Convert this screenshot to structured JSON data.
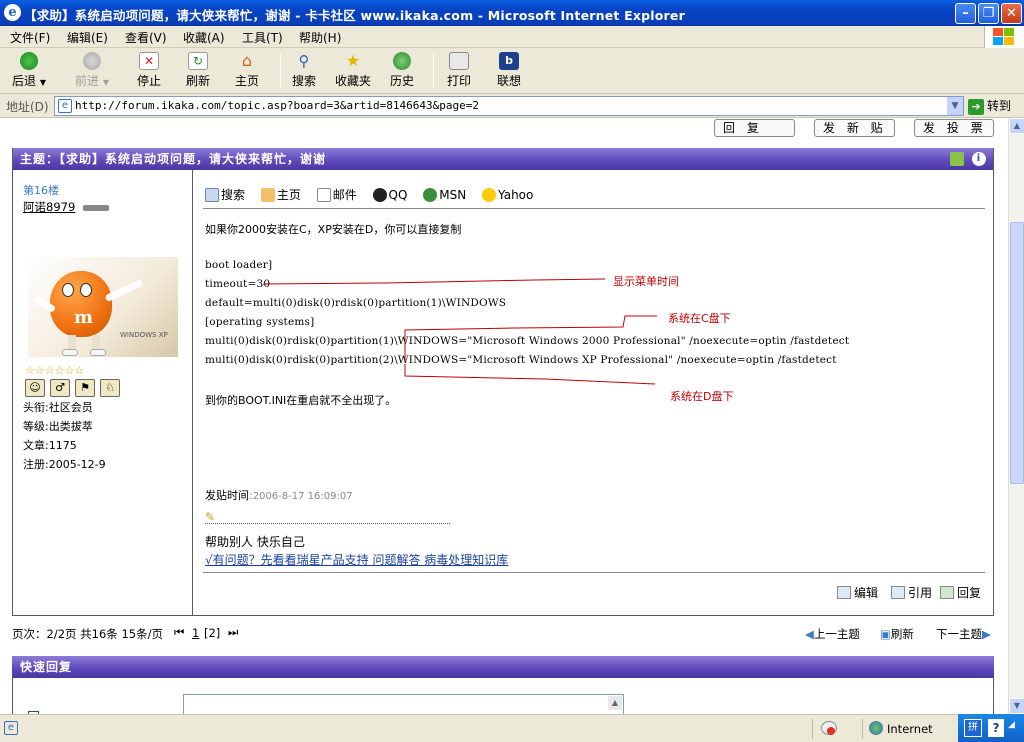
{
  "window": {
    "title": "【求助】系统启动项问题，请大侠来帮忙，谢谢 - 卡卡社区 www.ikaka.com - Microsoft Internet Explorer"
  },
  "menu": [
    "文件(F)",
    "编辑(E)",
    "查看(V)",
    "收藏(A)",
    "工具(T)",
    "帮助(H)"
  ],
  "toolbar": {
    "back": "后退",
    "forward": "前进",
    "stop": "停止",
    "refresh": "刷新",
    "home": "主页",
    "search": "搜索",
    "favorites": "收藏夹",
    "history": "历史",
    "print": "打印",
    "lenovo": "联想"
  },
  "address": {
    "label": "地址(D)",
    "url": "http://forum.ikaka.com/topic.asp?board=3&artid=8146643&page=2",
    "go": "转到"
  },
  "page": {
    "top_buttons": [
      "回 复",
      "发 新 贴",
      "发 投 票"
    ],
    "topic_header": "主题：【求助】系统启动项问题，请大侠来帮忙，谢谢",
    "post": {
      "floor": "第16楼",
      "username": "阿诺8979",
      "user_info": [
        "头衔:社区会员",
        "等级:出类拔萃",
        "文章:1175",
        "注册:2005-12-9"
      ],
      "links": [
        "搜索",
        "主页",
        "邮件",
        "QQ",
        "MSN",
        "Yahoo"
      ],
      "intro": "如果你2000安装在C，XP安装在D，你可以直接复制",
      "code": [
        "boot loader]",
        "timeout=30",
        "default=multi(0)disk(0)rdisk(0)partition(1)\\WINDOWS",
        "[operating systems]",
        "multi(0)disk(0)rdisk(0)partition(1)\\WINDOWS=\"Microsoft Windows 2000 Professional\" /noexecute=optin /fastdetect",
        "multi(0)disk(0)rdisk(0)partition(2)\\WINDOWS=\"Microsoft Windows XP Professional\" /noexecute=optin /fastdetect"
      ],
      "notes": {
        "menu_time": "显示菜单时间",
        "c_drive": "系统在C盘下",
        "d_drive": "系统在D盘下"
      },
      "outro": "到你的BOOT.INI在重启就不全出现了。",
      "post_time_label": "发贴时间",
      "post_time": "2006-8-17 16:09:07",
      "signature": "帮助别人 快乐自己",
      "sig_link": "√有问题？先看看瑞星产品支持 问题解答 病毒处理知识库",
      "actions": [
        "编辑",
        "引用",
        "回复"
      ]
    },
    "pager": {
      "summary": "页次：2/2页 共16条 15条/页",
      "page1": "1",
      "page2": "[2]",
      "prev_topic": "上一主题",
      "refresh": "刷新",
      "next_topic": "下一主题"
    },
    "quick_reply": "快速回复"
  },
  "status": {
    "zone": "Internet"
  }
}
